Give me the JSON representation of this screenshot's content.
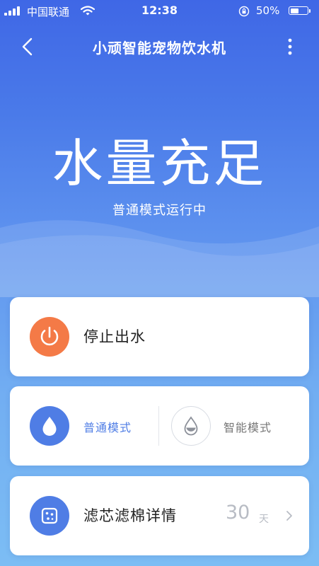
{
  "status_bar": {
    "carrier": "中国联通",
    "time": "12:38",
    "battery_percent": "50%",
    "battery_level": 0.5
  },
  "header": {
    "title": "小顽智能宠物饮水机"
  },
  "hero": {
    "status": "水量充足",
    "mode_status": "普通模式运行中"
  },
  "controls": {
    "power": {
      "label": "停止出水",
      "icon": "power-icon",
      "color": "#f47a47"
    },
    "modes": [
      {
        "label": "普通模式",
        "icon": "water-drop-icon",
        "active": true,
        "color": "#4f7de5"
      },
      {
        "label": "智能模式",
        "icon": "water-drop-half-icon",
        "active": false,
        "color": "#777777"
      }
    ],
    "filter": {
      "label": "滤芯滤棉详情",
      "days": "30",
      "unit": "天",
      "icon": "filter-icon"
    }
  },
  "colors": {
    "accent": "#4f7de5",
    "power": "#f47a47",
    "header_gradient_top": "#3f67e6",
    "background_bottom": "#7cbdf4"
  }
}
